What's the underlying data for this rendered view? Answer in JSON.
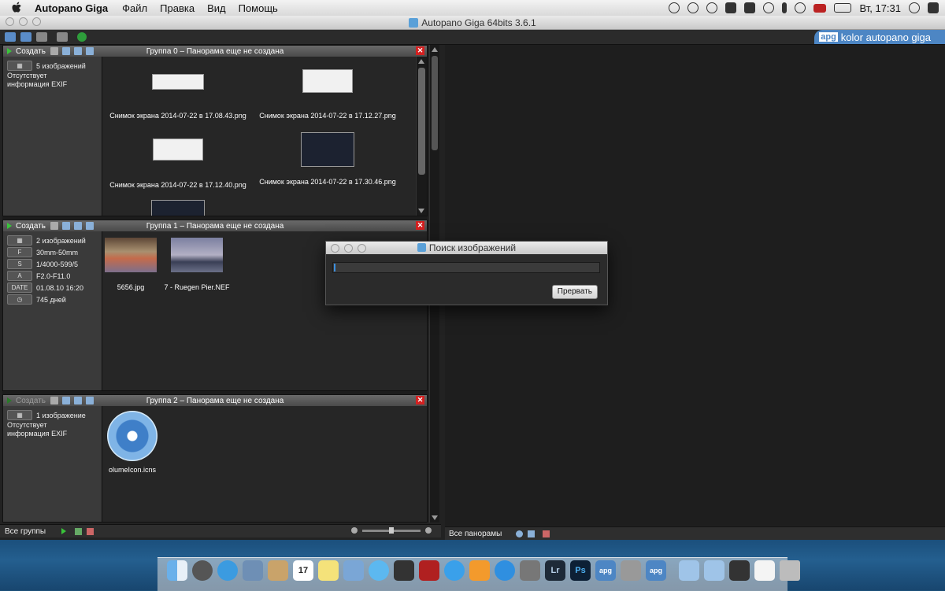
{
  "menubar": {
    "app_name": "Autopano Giga",
    "items": [
      "Файл",
      "Правка",
      "Вид",
      "Помощь"
    ],
    "clock": "Вт, 17:31"
  },
  "window": {
    "title": "Autopano Giga 64bits 3.6.1"
  },
  "brand": {
    "badge": "apg",
    "text": "kolor autopano giga"
  },
  "groups": [
    {
      "create_label": "Создать",
      "title": "Группа 0 – Панорама еще не создана",
      "info": [
        "5 изображений",
        "Отсутствует информация EXIF"
      ],
      "thumbs": [
        "Снимок экрана 2014-07-22 в 17.08.43.png",
        "Снимок экрана 2014-07-22 в 17.12.27.png",
        "Снимок экрана 2014-07-22 в 17.12.40.png",
        "Снимок экрана 2014-07-22 в 17.30.46.png"
      ]
    },
    {
      "create_label": "Создать",
      "title": "Группа 1 – Панорама еще не создана",
      "info_rows": [
        {
          "tag": "",
          "value": "2 изображений"
        },
        {
          "tag": "F",
          "value": "30mm-50mm"
        },
        {
          "tag": "S",
          "value": "1/4000-599/5"
        },
        {
          "tag": "A",
          "value": "F2.0-F11.0"
        },
        {
          "tag": "DATE",
          "value": "01.08.10 16:20"
        },
        {
          "tag": "",
          "value": "745 дней"
        }
      ],
      "thumbs": [
        "5656.jpg",
        "7 - Ruegen Pier.NEF"
      ]
    },
    {
      "create_label": "Создать",
      "title": "Группа 2 – Панорама еще не создана",
      "info": [
        "1 изображение",
        "Отсутствует информация EXIF"
      ],
      "thumbs": [
        "olumeIcon.icns"
      ]
    }
  ],
  "bottom": {
    "left_label": "Все группы",
    "right_label": "Все панорамы"
  },
  "dialog": {
    "title": "Поиск изображений",
    "button": "Прервать"
  },
  "dock": {
    "icons": [
      "Finder",
      "Launchpad",
      "Safari",
      "Mail",
      "Contacts",
      "Calendar",
      "Notes",
      "Preview",
      "Messages",
      "FaceTime",
      "Photo Booth",
      "iTunes",
      "iBooks",
      "App Store",
      "System Preferences",
      "Lr",
      "Ps",
      "apg",
      "Disk Utility",
      "apg",
      "Downloads",
      "Documents",
      "Screenshot",
      "TextEdit",
      "Trash"
    ],
    "calendar_day": "17"
  },
  "colors": {
    "accent": "#4d86c4",
    "close": "#d42020",
    "play": "#39c43a"
  }
}
